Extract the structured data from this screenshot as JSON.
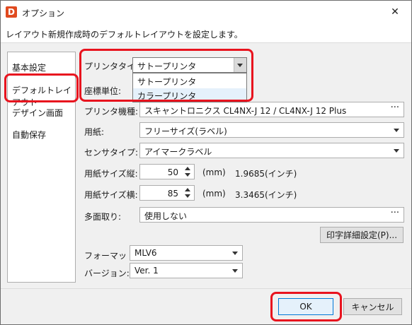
{
  "window": {
    "app_icon_letter": "D",
    "title": "オプション",
    "close_glyph": "✕",
    "subtitle": "レイアウト新規作成時のデフォルトレイアウトを設定します。"
  },
  "nav": {
    "items": [
      {
        "label": "基本設定"
      },
      {
        "label": "デフォルトレイアウト"
      },
      {
        "label": "デザイン画面"
      },
      {
        "label": "自動保存"
      }
    ],
    "selected": "デフォルトレイアウト"
  },
  "form": {
    "printer_type": {
      "label": "プリンタタイプ:",
      "value": "サトープリンタ",
      "options": [
        "サトープリンタ",
        "カラープリンタ"
      ],
      "hovered_option": "カラープリンタ"
    },
    "coord_unit": {
      "label": "座標単位:"
    },
    "printer_model": {
      "label": "プリンタ機種:",
      "value": "スキャントロニクス CL4NX-J 12 / CL4NX-J 12 Plus"
    },
    "paper": {
      "label": "用紙:",
      "value": "フリーサイズ(ラベル)"
    },
    "sensor_type": {
      "label": "センサタイプ:",
      "value": "アイマークラベル"
    },
    "paper_height": {
      "label": "用紙サイズ縦:",
      "value": "50",
      "unit": "(mm)",
      "inch": "1.9685(インチ)"
    },
    "paper_width": {
      "label": "用紙サイズ横:",
      "value": "85",
      "unit": "(mm)",
      "inch": "3.3465(インチ)"
    },
    "multi_face": {
      "label": "多面取り:",
      "value": "使用しない"
    },
    "print_detail_button": "印字詳細設定(P)...",
    "format": {
      "label": "フォーマット:",
      "value": "MLV6"
    },
    "version": {
      "label": "バージョン:",
      "value": "Ver. 1"
    },
    "ellipsis": "···"
  },
  "buttons": {
    "ok": "OK",
    "cancel": "キャンセル"
  },
  "colors": {
    "highlight": "#e8131e",
    "ok_border": "#0078d7",
    "app_icon": "#e04a1f"
  }
}
